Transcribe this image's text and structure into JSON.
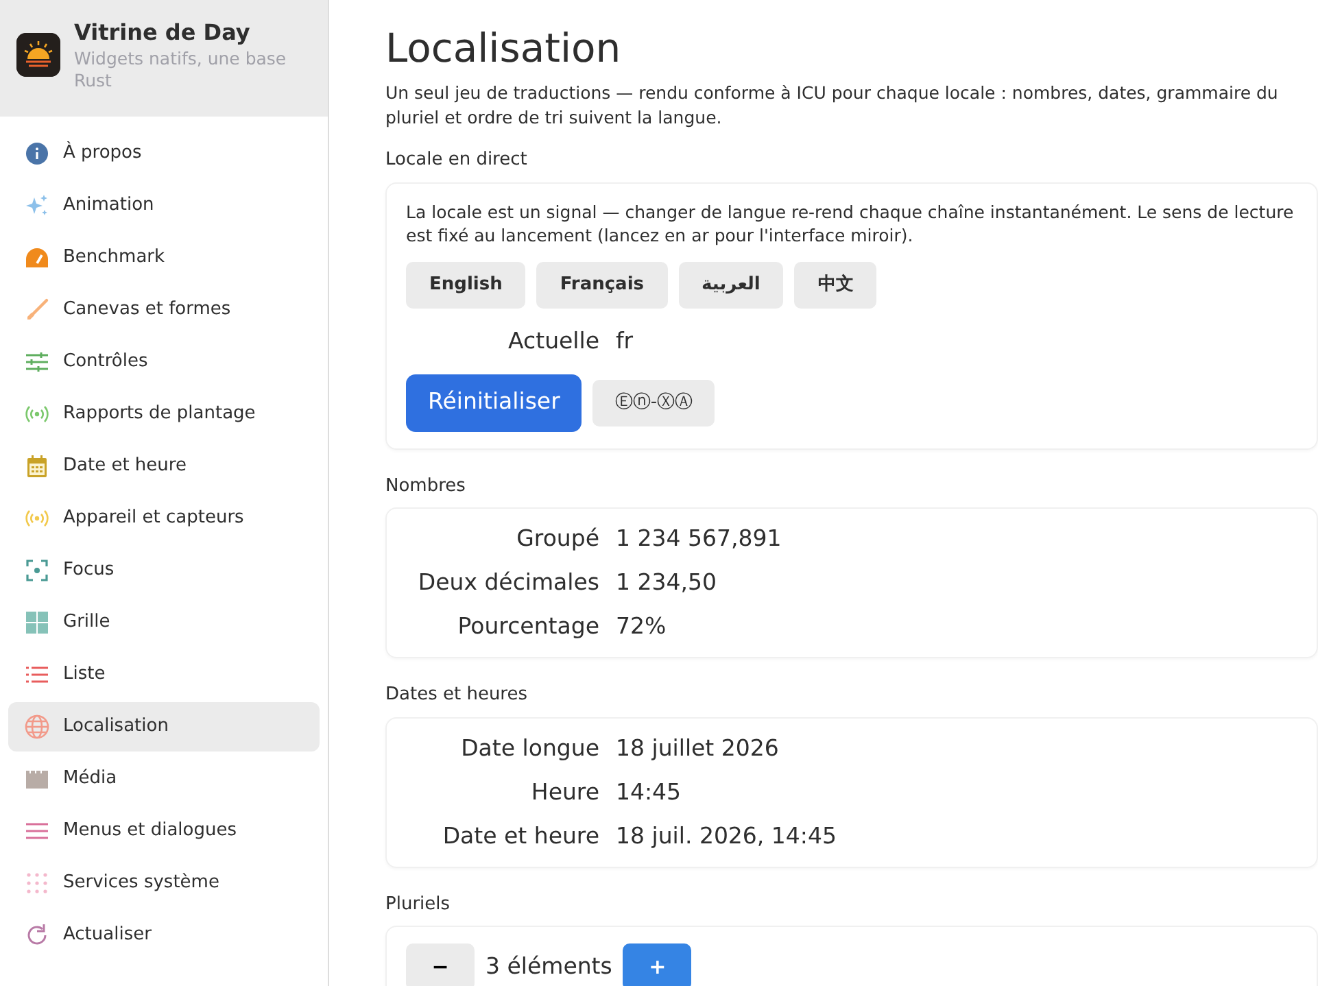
{
  "app": {
    "title": "Vitrine de Day",
    "subtitle": "Widgets natifs, une base Rust"
  },
  "sidebar": {
    "items": [
      {
        "label": "À propos",
        "selected": false
      },
      {
        "label": "Animation",
        "selected": false
      },
      {
        "label": "Benchmark",
        "selected": false
      },
      {
        "label": "Canevas et formes",
        "selected": false
      },
      {
        "label": "Contrôles",
        "selected": false
      },
      {
        "label": "Rapports de plantage",
        "selected": false
      },
      {
        "label": "Date et heure",
        "selected": false
      },
      {
        "label": "Appareil et capteurs",
        "selected": false
      },
      {
        "label": "Focus",
        "selected": false
      },
      {
        "label": "Grille",
        "selected": false
      },
      {
        "label": "Liste",
        "selected": false
      },
      {
        "label": "Localisation",
        "selected": true
      },
      {
        "label": "Média",
        "selected": false
      },
      {
        "label": "Menus et dialogues",
        "selected": false
      },
      {
        "label": "Services système",
        "selected": false
      },
      {
        "label": "Actualiser",
        "selected": false
      }
    ]
  },
  "page": {
    "title": "Localisation",
    "intro": "Un seul jeu de traductions — rendu conforme à ICU pour chaque locale : nombres, dates, grammaire du pluriel et ordre de tri suivent la langue."
  },
  "sections": [
    {
      "kind": "locale",
      "heading": "Locale en direct",
      "note": "La locale est un signal — changer de langue re-rend chaque chaîne instantanément. Le sens de lecture est fixé au lancement (lancez en ar pour l'interface miroir).",
      "languages": [
        "English",
        "Français",
        "العربية",
        "中文"
      ],
      "current_label": "Actuelle",
      "current_value": "fr",
      "reset_button": "Réinitialiser",
      "pseudo_button": "Ⓔⓝ-ⓍⒶ"
    },
    {
      "kind": "rows",
      "heading": "Nombres",
      "rows": [
        {
          "label": "Groupé",
          "value": "1 234 567,891"
        },
        {
          "label": "Deux décimales",
          "value": "1 234,50"
        },
        {
          "label": "Pourcentage",
          "value": "72%"
        }
      ]
    },
    {
      "kind": "rows",
      "heading": "Dates et heures",
      "rows": [
        {
          "label": "Date longue",
          "value": "18 juillet 2026"
        },
        {
          "label": "Heure",
          "value": "14:45"
        },
        {
          "label": "Date et heure",
          "value": "18 juil. 2026, 14:45"
        }
      ]
    },
    {
      "kind": "counter",
      "heading": "Pluriels",
      "minus": "−",
      "count": "3 éléments",
      "plus": "+"
    }
  ]
}
